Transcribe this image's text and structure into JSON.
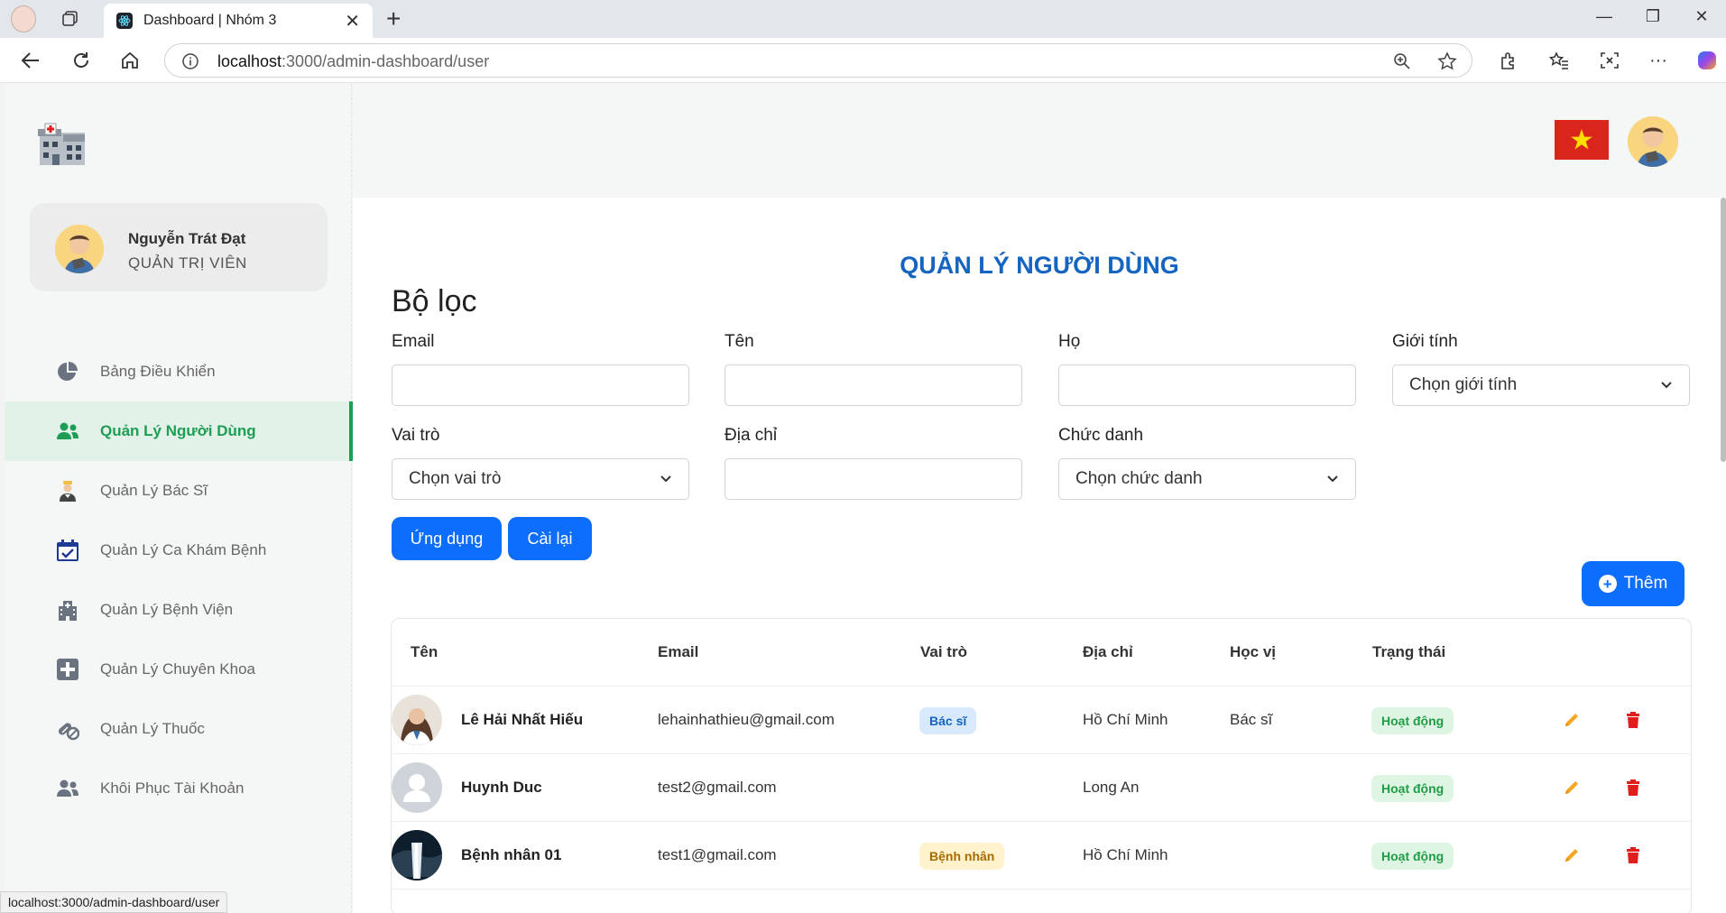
{
  "browser": {
    "tab_title": "Dashboard | Nhóm 3",
    "url_host": "localhost",
    "url_path": ":3000/admin-dashboard/user",
    "status_url": "localhost:3000/admin-dashboard/user"
  },
  "sidebar": {
    "user": {
      "name": "Nguyễn Trát Đạt",
      "role": "QUẢN TRỊ VIÊN"
    },
    "items": [
      {
        "label": "Bảng Điều Khiển",
        "icon": "pie-chart-icon"
      },
      {
        "label": "Quản Lý Người Dùng",
        "icon": "users-icon",
        "active": true
      },
      {
        "label": "Quản Lý Bác Sĩ",
        "icon": "doctor-icon"
      },
      {
        "label": "Quản Lý Ca Khám Bệnh",
        "icon": "calendar-check-icon"
      },
      {
        "label": "Quản Lý Bệnh Viện",
        "icon": "hospital-icon"
      },
      {
        "label": "Quản Lý Chuyên Khoa",
        "icon": "plus-square-icon"
      },
      {
        "label": "Quản Lý Thuốc",
        "icon": "pills-icon"
      },
      {
        "label": "Khôi Phục Tài Khoản",
        "icon": "users-restore-icon"
      }
    ]
  },
  "page": {
    "title": "QUẢN LÝ NGƯỜI DÙNG",
    "filter_title": "Bộ lọc",
    "filters": {
      "email": {
        "label": "Email",
        "value": ""
      },
      "first_name": {
        "label": "Tên",
        "value": ""
      },
      "last_name": {
        "label": "Họ",
        "value": ""
      },
      "gender": {
        "label": "Giới tính",
        "selected": "Chọn giới tính"
      },
      "role": {
        "label": "Vai trò",
        "selected": "Chọn vai trò"
      },
      "address": {
        "label": "Địa chỉ",
        "value": ""
      },
      "position": {
        "label": "Chức danh",
        "selected": "Chọn chức danh"
      }
    },
    "apply_label": "Ứng dụng",
    "reset_label": "Cài lại",
    "add_label": "Thêm"
  },
  "table": {
    "headers": [
      "Tên",
      "Email",
      "Vai trò",
      "Địa chỉ",
      "Học vị",
      "Trạng thái"
    ],
    "rows": [
      {
        "name": "Lê Hải Nhất Hiếu",
        "email": "lehainhathieu@gmail.com",
        "role": "Bác sĩ",
        "address": "Hồ Chí Minh",
        "degree": "Bác sĩ",
        "status": "Hoạt động"
      },
      {
        "name": "Huynh Duc",
        "email": "test2@gmail.com",
        "role": "",
        "address": "Long An",
        "degree": "",
        "status": "Hoạt động"
      },
      {
        "name": "Bệnh nhân 01",
        "email": "test1@gmail.com",
        "role": "Bệnh nhân",
        "address": "Hồ Chí Minh",
        "degree": "",
        "status": "Hoạt động"
      }
    ]
  },
  "colors": {
    "accent": "#0d6efd",
    "active_green": "#1e9d55",
    "title_blue": "#1565c0",
    "delete_red": "#e01e1e",
    "edit_orange": "#f5a623"
  }
}
